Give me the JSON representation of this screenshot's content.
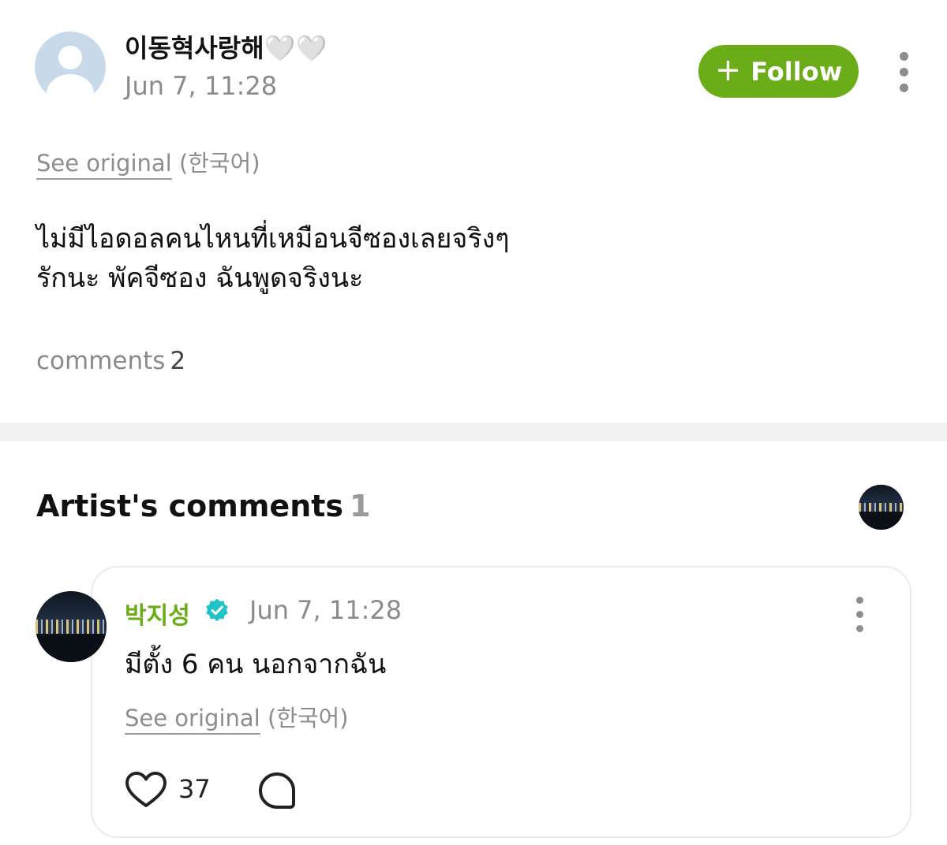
{
  "post": {
    "author_name": "이동혁사랑해",
    "author_suffix": "🤍🤍",
    "date": "Jun 7, 11:28",
    "follow_label": "Follow",
    "follow_icon": "+",
    "see_original_link": "See original",
    "see_original_lang": "(한국어)",
    "body_line1": "ไม่มีไอดอลคนไหนที่เหมือนจีซองเลยจริงๆ",
    "body_line2": "รักนะ พัคจีซอง ฉันพูดจริงนะ",
    "comments_label": "comments",
    "comments_count": "2"
  },
  "artist_comments": {
    "heading": "Artist's comments",
    "count": "1",
    "comment": {
      "author": "박지성",
      "date": "Jun 7, 11:28",
      "text": "มีตั้ง 6 คน นอกจากฉัน",
      "see_original_link": "See original",
      "see_original_lang": "(한국어)",
      "like_count": "37"
    }
  },
  "colors": {
    "accent_green": "#6bad18",
    "verified_teal": "#22c3c8",
    "muted_text": "#8b8b8b"
  },
  "icons": [
    "default-avatar-icon",
    "more-icon",
    "plus-icon",
    "verified-badge-icon",
    "heart-icon",
    "comment-bubble-icon"
  ]
}
